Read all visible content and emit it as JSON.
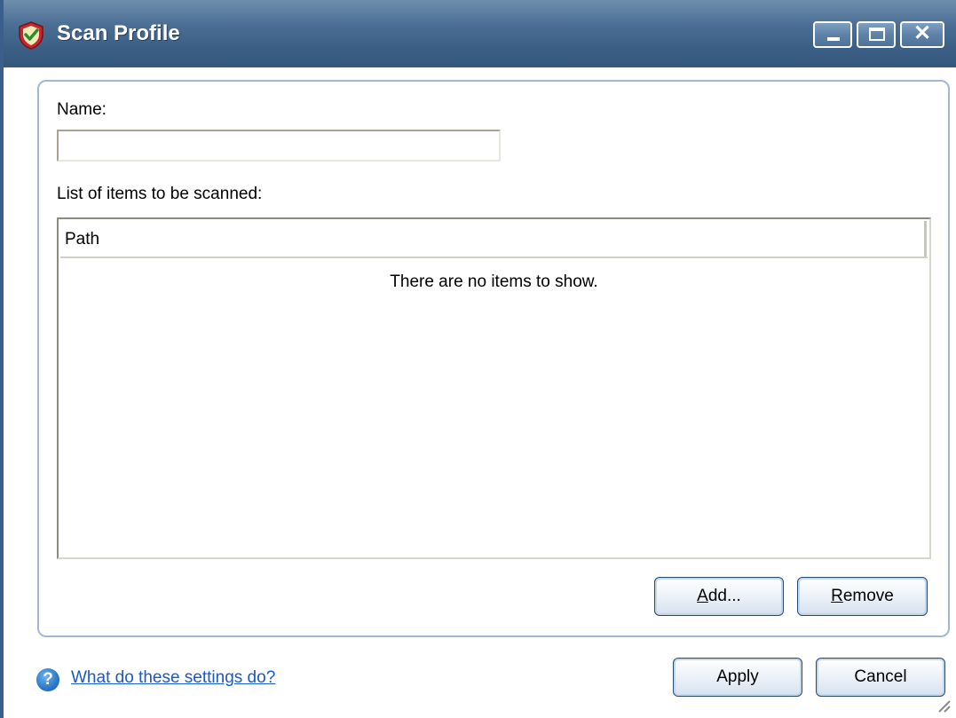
{
  "window": {
    "title": "Scan Profile",
    "controls": {
      "minimize": "–",
      "maximize": "□",
      "close": "✕"
    }
  },
  "form": {
    "name_label": "Name:",
    "name_value": "",
    "list_label": "List of items to be scanned:",
    "list": {
      "columns": [
        "Path"
      ],
      "rows": [],
      "empty_text": "There are no items to show."
    },
    "add_button": {
      "mnemonic": "A",
      "rest": "dd..."
    },
    "remove_button": {
      "mnemonic": "R",
      "rest": "emove"
    }
  },
  "footer": {
    "help_icon": "help-icon",
    "help_link": "What do these settings do?",
    "apply_label": "Apply",
    "cancel_label": "Cancel"
  },
  "colors": {
    "titlebar": "#3c5f86",
    "panel_border": "#9fb9d4",
    "link": "#1a59c8"
  }
}
